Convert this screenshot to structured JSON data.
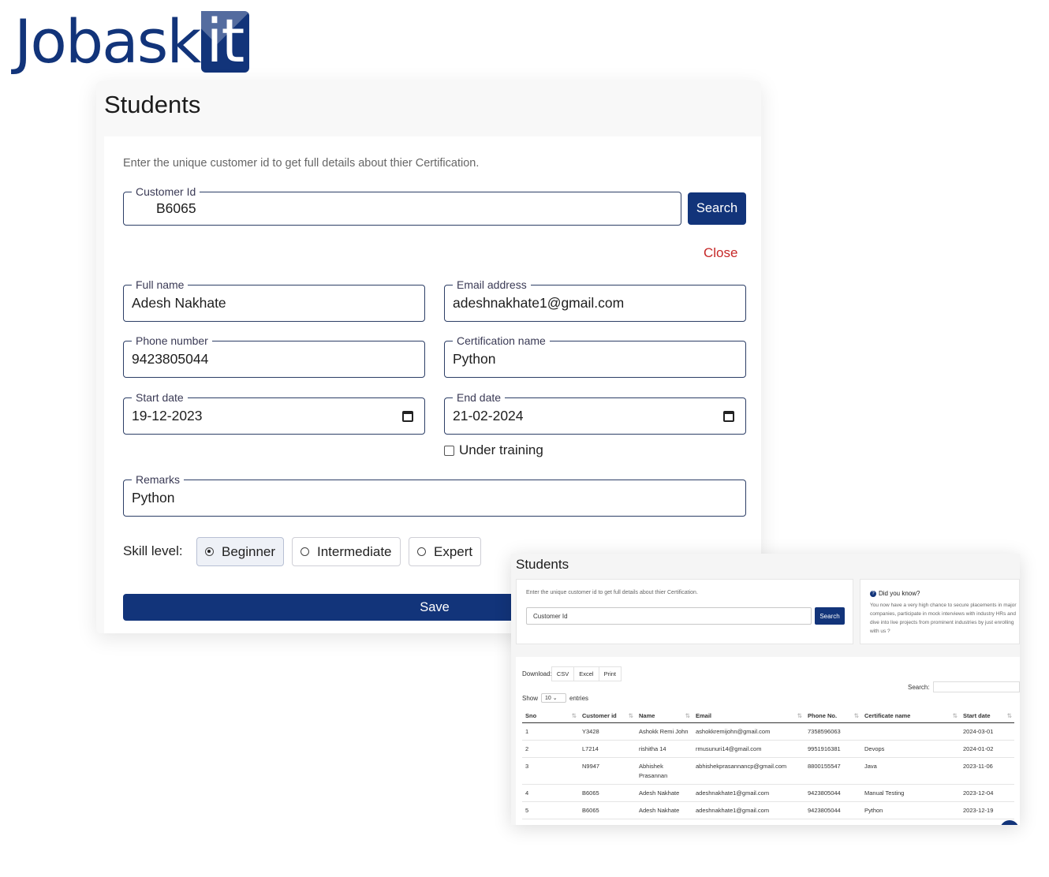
{
  "brand": {
    "logo_main": "Jobask",
    "logo_box": "it"
  },
  "main": {
    "title": "Students",
    "hint": "Enter the unique customer id to get full details about thier Certification.",
    "customer_id": {
      "label": "Customer Id",
      "value": "B6065"
    },
    "search_label": "Search",
    "close_label": "Close",
    "fields": {
      "full_name": {
        "label": "Full name",
        "value": "Adesh Nakhate"
      },
      "email": {
        "label": "Email address",
        "value": "adeshnakhate1@gmail.com"
      },
      "phone": {
        "label": "Phone number",
        "value": "9423805044"
      },
      "cert": {
        "label": "Certification name",
        "value": "Python"
      },
      "start": {
        "label": "Start date",
        "value": "19-12-2023"
      },
      "end": {
        "label": "End date",
        "value": "21-02-2024"
      },
      "remarks": {
        "label": "Remarks",
        "value": "Python"
      }
    },
    "under_training_label": "Under training",
    "under_training_checked": false,
    "skill_label": "Skill level:",
    "skill_options": [
      "Beginner",
      "Intermediate",
      "Expert"
    ],
    "skill_selected": "Beginner",
    "save_label": "Save"
  },
  "sub": {
    "title": "Students",
    "hint": "Enter the unique customer id to get full details about thier Certification.",
    "input_placeholder": "Customer Id",
    "search_label": "Search",
    "did_you_know_title": "Did you know?",
    "did_you_know_body": "You now have a very high chance to secure placements in major companies, participate in mock interviews with industry HRs and dive into live projects from prominent industries by just enrolling with us ?",
    "download_label": "Download:",
    "download_buttons": [
      "CSV",
      "Excel",
      "Print"
    ],
    "search_field_label": "Search:",
    "show_label": "Show",
    "show_value": "10",
    "entries_label": "entries",
    "columns": [
      "Sno",
      "Customer id",
      "Name",
      "Email",
      "Phone No.",
      "Certificate name",
      "Start date"
    ],
    "rows": [
      [
        "1",
        "Y3428",
        "Ashokk Remi John",
        "ashokkremijohn@gmail.com",
        "7358596063",
        "",
        "2024-03-01"
      ],
      [
        "2",
        "L7214",
        "rishitha 14",
        "rmusunuri14@gmail.com",
        "9951916381",
        "Devops",
        "2024-01-02"
      ],
      [
        "3",
        "N9947",
        "Abhishek Prasannan",
        "abhishekprasannancp@gmail.com",
        "8800155547",
        "Java",
        "2023-11-06"
      ],
      [
        "4",
        "B6065",
        "Adesh Nakhate",
        "adeshnakhate1@gmail.com",
        "9423805044",
        "Manual Testing",
        "2023-12-04"
      ],
      [
        "5",
        "B6065",
        "Adesh Nakhate",
        "adeshnakhate1@gmail.com",
        "9423805044",
        "Python",
        "2023-12-19"
      ]
    ]
  },
  "colors": {
    "brand_blue": "#12347a",
    "close_red": "#c62828"
  }
}
